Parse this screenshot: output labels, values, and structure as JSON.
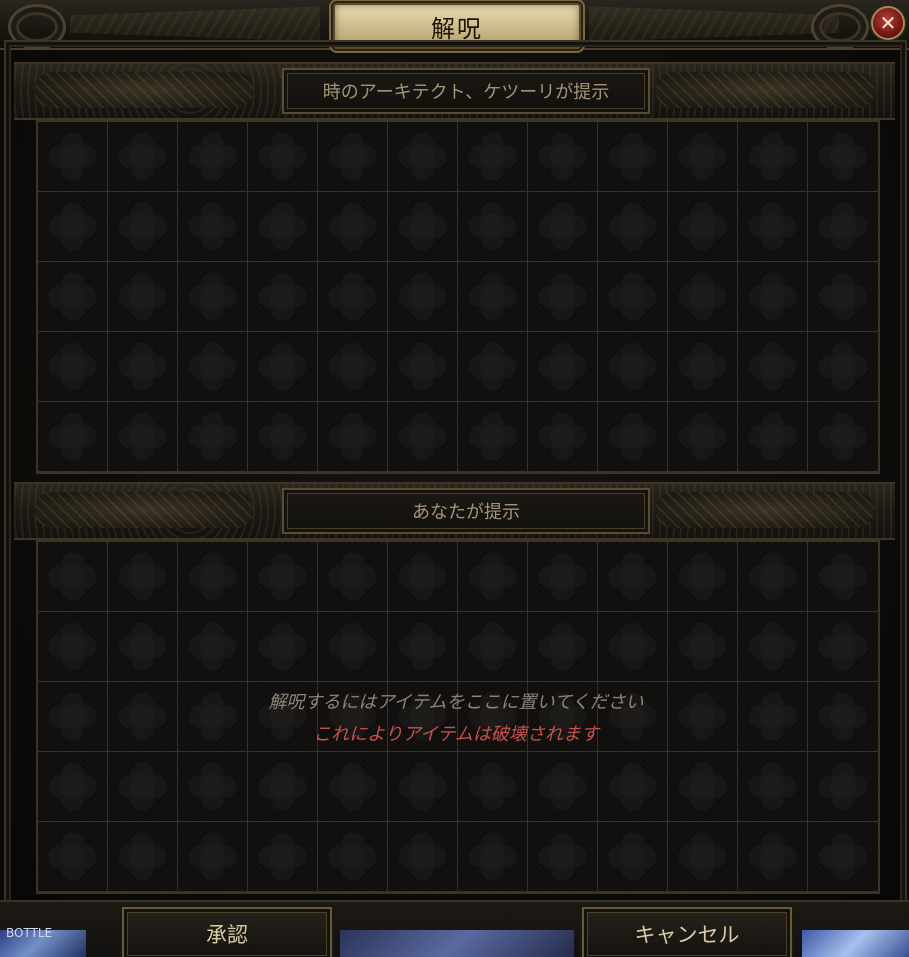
{
  "window": {
    "title": "解呪",
    "close_icon": "close-icon"
  },
  "sections": {
    "top": {
      "label": "時のアーキテクト、ケツーリが提示"
    },
    "bottom": {
      "label": "あなたが提示"
    }
  },
  "instructions": {
    "line1": "解呪するにはアイテムをここに置いてください",
    "line2": "これによりアイテムは破壊されます"
  },
  "buttons": {
    "confirm": "承認",
    "cancel": "キャンセル"
  },
  "background": {
    "peek_text": "BOTTLE"
  },
  "colors": {
    "title_plaque": "#d2c190",
    "warning_text": "#c9504a",
    "hint_text": "#8b8478",
    "label_text": "#a49377"
  },
  "grid": {
    "columns": 12,
    "rows": 5
  }
}
